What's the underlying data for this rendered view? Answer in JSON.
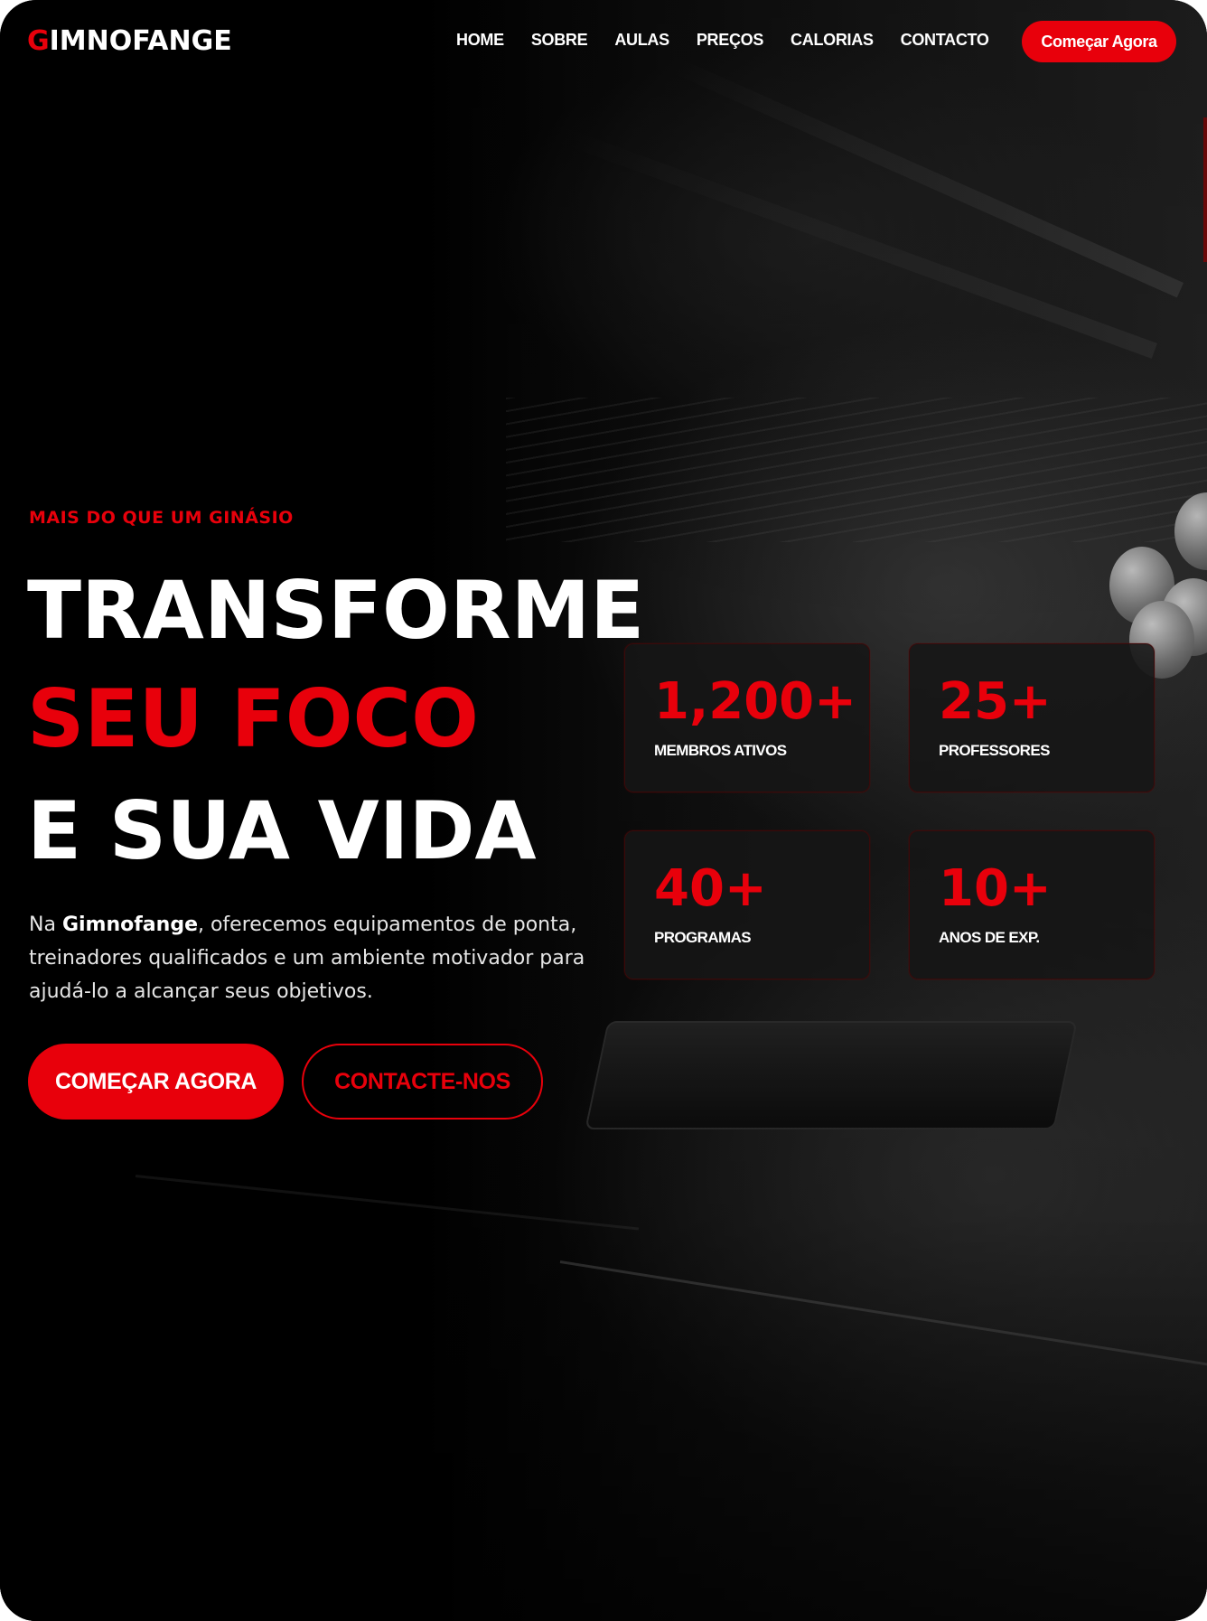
{
  "brand": {
    "logo_first": "G",
    "logo_rest": "IMNOFANGE",
    "accent_color": "#e8000b"
  },
  "nav": {
    "items": [
      {
        "label": "HOME"
      },
      {
        "label": "SOBRE"
      },
      {
        "label": "AULAS"
      },
      {
        "label": "PREÇOS"
      },
      {
        "label": "CALORIAS"
      },
      {
        "label": "CONTACTO"
      }
    ],
    "cta_label": "Começar Agora"
  },
  "hero": {
    "eyebrow": "MAIS DO QUE UM GINÁSIO",
    "headline_line1": "TRANSFORME",
    "headline_line2": "SEU FOCO",
    "headline_line3": "E SUA VIDA",
    "lead_prefix": "Na ",
    "lead_brand": "Gimnofange",
    "lead_suffix": ", oferecemos equipamentos de ponta, treinadores qualificados e um ambiente motivador para ajudá-lo a alcançar seus objetivos.",
    "primary_button": "COMEÇAR AGORA",
    "secondary_button": "CONTACTE-NOS"
  },
  "stats": [
    {
      "value": "1,200+",
      "label": "MEMBROS ATIVOS"
    },
    {
      "value": "25+",
      "label": "PROFESSORES"
    },
    {
      "value": "40+",
      "label": "PROGRAMAS"
    },
    {
      "value": "10+",
      "label": "ANOS DE EXP."
    }
  ]
}
